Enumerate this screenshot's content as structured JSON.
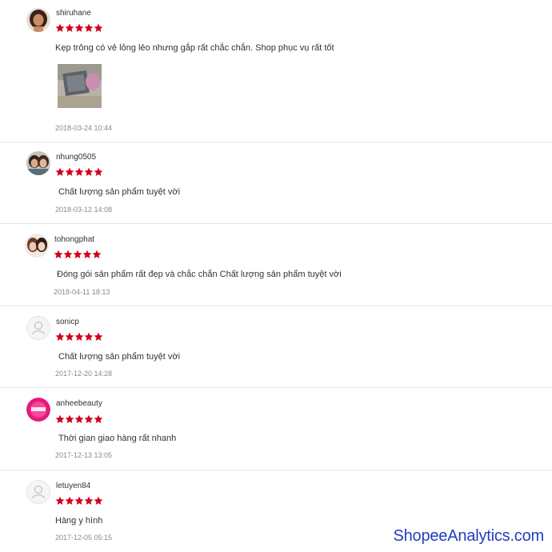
{
  "reviews": [
    {
      "username": "shiruhane",
      "rating": 5,
      "comment": "Kẹp trông có vẻ lỏng lẻo nhưng gắp rất chắc chắn. Shop phục vụ rất tốt",
      "timestamp": "2018-03-24 10:44",
      "avatar": "user-photo-avatar",
      "has_photo": true
    },
    {
      "username": "nhung0505",
      "rating": 5,
      "comment": "Chất lượng sản phẩm tuyệt vời",
      "timestamp": "2018-03-12 14:08",
      "avatar": "user-photo-avatar"
    },
    {
      "username": "tohongphat",
      "rating": 5,
      "comment": "Đóng gói sản phẩm rất đẹp và chắc chắn Chất lượng sản phẩm tuyệt vời",
      "timestamp": "2018-04-11 18:13",
      "avatar": "user-photo-avatar"
    },
    {
      "username": "sonicp",
      "rating": 5,
      "comment": "Chất lượng sản phẩm tuyệt vời",
      "timestamp": "2017-12-20 14:28",
      "avatar": "default-user-icon"
    },
    {
      "username": "anheebeauty",
      "rating": 5,
      "comment": "Thời gian giao hàng rất nhanh",
      "timestamp": "2017-12-13 13:05",
      "avatar": "brand-logo-avatar"
    },
    {
      "username": "letuyen84",
      "rating": 5,
      "comment": "Hàng y hình",
      "timestamp": "2017-12-05 05:15",
      "avatar": "default-user-icon"
    }
  ],
  "colors": {
    "star": "#d0011b",
    "brand_avatar": "#e6197a",
    "watermark": "#1f3fbf"
  },
  "watermark": "ShopeeAnalytics.com"
}
